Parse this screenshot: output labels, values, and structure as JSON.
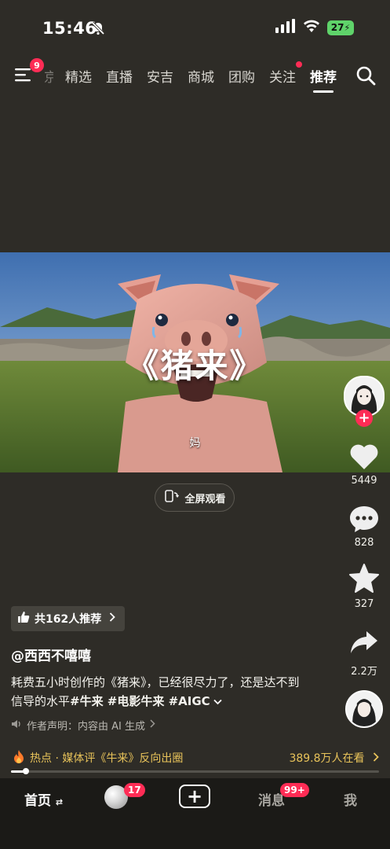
{
  "status_bar": {
    "time": "15:46",
    "battery": "27"
  },
  "top_nav": {
    "menu_badge": "9",
    "partial_tab": "京",
    "tabs": [
      "精选",
      "直播",
      "安吉",
      "商城",
      "团购",
      "关注",
      "推荐"
    ],
    "active_tab": "推荐"
  },
  "video": {
    "title": "《猪来》",
    "subtitle": "妈",
    "fullscreen_label": "全屏观看"
  },
  "right_rail": {
    "likes": "5449",
    "comments": "828",
    "favorites": "327",
    "shares": "2.2万"
  },
  "info": {
    "recommend_label": "共162人推荐",
    "author": "@西西不嘻嘻",
    "description": "耗费五小时创作的《猪来》，已经很尽力了，还是达不到信导的水平",
    "tags": "#牛来 #电影牛来 #AIGC",
    "declaration": "作者声明：内容由 AI 生成"
  },
  "hot_bar": {
    "hot_text": "热点 · 媒体评《牛来》反向出圈",
    "viewers": "389.8万人在看"
  },
  "progress": {
    "fraction": 0.04
  },
  "tabbar": {
    "home": "首页",
    "friends_badge": "17",
    "messages": "消息",
    "messages_badge": "99+",
    "me": "我"
  },
  "colors": {
    "accent": "#fe2c55",
    "hot": "#e8c35a",
    "background": "#2e2c27"
  }
}
